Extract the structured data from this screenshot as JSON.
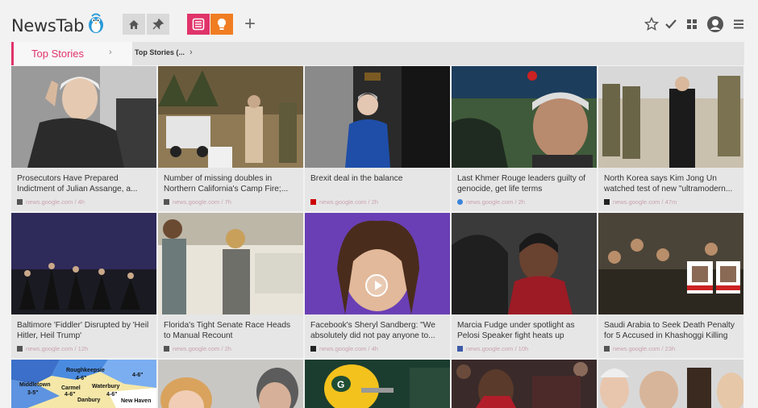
{
  "app": {
    "name": "NewsTab"
  },
  "toolbar": {
    "home_icon": "home-icon",
    "pin_icon": "pin-icon",
    "news_icon": "news-icon",
    "idea_icon": "lightbulb-icon",
    "add_label": "+",
    "colors": {
      "pink": "#e0346a",
      "orange": "#f07d22"
    }
  },
  "breadcrumb": {
    "first": "Top Stories",
    "second": "Top Stories (...",
    "chevron": "›"
  },
  "cards": [
    {
      "title": "Prosecutors Have Prepared Indictment of Julian Assange, a...",
      "source": "news.google.com / 4h"
    },
    {
      "title": "Number of missing doubles in Northern California's Camp Fire;...",
      "source": "news.google.com / 7h"
    },
    {
      "title": "Brexit deal in the balance",
      "source": "news.google.com / 2h"
    },
    {
      "title": "Last Khmer Rouge leaders guilty of genocide, get life terms",
      "source": "news.google.com / 2h"
    },
    {
      "title": "North Korea says Kim Jong Un watched test of new \"ultramodern...",
      "source": "news.google.com / 47m"
    },
    {
      "title": "Baltimore 'Fiddler' Disrupted by 'Heil Hitler, Heil Trump'",
      "source": "news.google.com / 12h"
    },
    {
      "title": "Florida's Tight Senate Race Heads to Manual Recount",
      "source": "news.google.com / 2h"
    },
    {
      "title": "Facebook's Sheryl Sandberg: \"We absolutely did not pay anyone to...",
      "source": "news.google.com / 4h"
    },
    {
      "title": "Marcia Fudge under spotlight as Pelosi Speaker fight heats up",
      "source": "news.google.com / 10h"
    },
    {
      "title": "Saudi Arabia to Seek Death Penalty for 5 Accused in Khashoggi Killing",
      "source": "news.google.com / 23h"
    },
    {
      "title": "",
      "source": ""
    },
    {
      "title": "",
      "source": ""
    },
    {
      "title": "",
      "source": ""
    },
    {
      "title": "",
      "source": ""
    },
    {
      "title": "",
      "source": ""
    }
  ],
  "map_labels": [
    "Roughkeepsie",
    "Waterbury",
    "Middletown",
    "Carmel",
    "Danbury",
    "New Haven"
  ],
  "map_values": [
    "4-6\"",
    "4-6\"",
    "3-5\"",
    "4-6\"",
    "4-6\""
  ]
}
